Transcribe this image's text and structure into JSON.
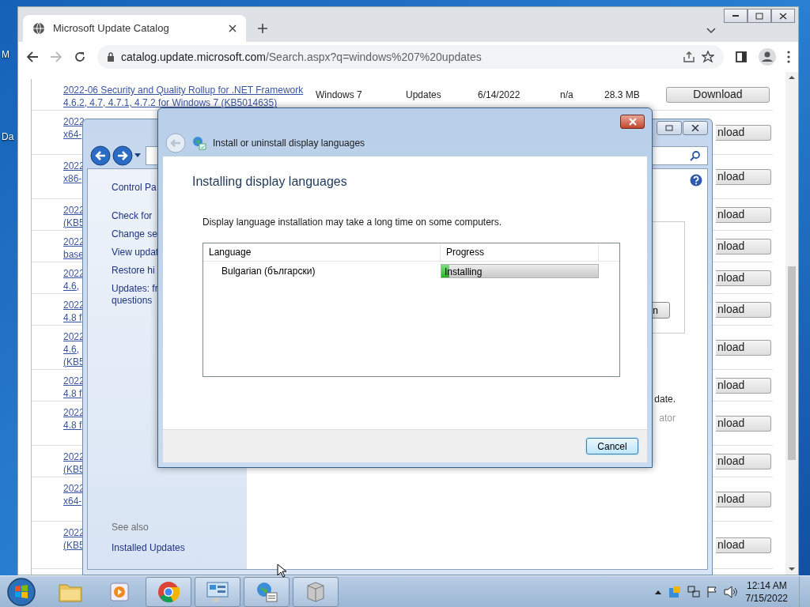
{
  "desktop": {
    "icon_labels": [
      "M",
      "Da"
    ]
  },
  "browser": {
    "tab_title": "Microsoft Update Catalog",
    "url_host": "catalog.update.microsoft.com",
    "url_path": "/Search.aspx?q=windows%207%20updates",
    "rows": [
      {
        "title_lines": [
          "2022-06 Security and Quality Rollup for .NET Framework",
          "4.6.2, 4.7, 4.7.1, 4.7.2 for Windows 7 (KB5014635)"
        ],
        "product": "Windows 7",
        "classification": "Updates",
        "last_updated": "6/14/2022",
        "version": "n/a",
        "size": "28.3 MB",
        "button": "Download"
      },
      {
        "title_lines": [
          "2022",
          "x64-"
        ],
        "button": "nload"
      },
      {
        "title_lines": [
          "2022",
          "x86-"
        ],
        "button": "nload"
      },
      {
        "title_lines": [
          "2022",
          "(KB5"
        ],
        "button": "nload"
      },
      {
        "title_lines": [
          "2022",
          "base"
        ],
        "button": "nload"
      },
      {
        "title_lines": [
          "2022",
          "4.6,"
        ],
        "button": "nload"
      },
      {
        "title_lines": [
          "2022",
          "4.8 f"
        ],
        "button": "nload"
      },
      {
        "title_lines": [
          "2022",
          "4.6,",
          "(KB5"
        ],
        "button": "nload"
      },
      {
        "title_lines": [
          "2022",
          "4.8 f"
        ],
        "button": "nload"
      },
      {
        "title_lines": [
          "2022",
          "4.8 f"
        ],
        "button": "nload"
      },
      {
        "title_lines": [
          "2022",
          "(KB5"
        ],
        "button": "nload"
      },
      {
        "title_lines": [
          "2022",
          "x64-"
        ],
        "button": "nload"
      },
      {
        "title_lines": [
          "2022",
          "(KB5"
        ],
        "button": "nload"
      }
    ]
  },
  "control_panel": {
    "heading": "Control Pa",
    "links": [
      [
        "Check for"
      ],
      [
        "Change se"
      ],
      [
        "View updat"
      ],
      [
        "Restore hi"
      ],
      [
        "Updates: fr",
        "questions"
      ]
    ],
    "see_also": "See also",
    "see_also_links": [
      "Installed Updates"
    ],
    "box_button": "n",
    "text_lines": [
      {
        "text": "date.",
        "kind": "plain"
      },
      {
        "text": "ator",
        "kind": "muted"
      }
    ]
  },
  "dialog": {
    "title": "Install or uninstall display languages",
    "heading": "Installing display languages",
    "message": "Display language installation may take a long time on some computers.",
    "columns": [
      "Language",
      "Progress"
    ],
    "languages": [
      {
        "name": "Bulgarian (български)",
        "status": "Installing",
        "level": 0.05
      }
    ],
    "cancel": "Cancel"
  },
  "taskbar": {
    "apps": [
      {
        "kind": "folder",
        "open": false
      },
      {
        "kind": "media",
        "open": false
      },
      {
        "kind": "chrome",
        "open": true
      },
      {
        "kind": "control",
        "open": true
      },
      {
        "kind": "globe",
        "open": true
      },
      {
        "kind": "box",
        "open": true
      }
    ],
    "clock": {
      "time": "12:14 AM",
      "date": "7/15/2022"
    }
  }
}
